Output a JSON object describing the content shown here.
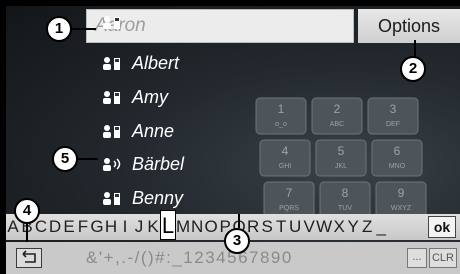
{
  "search": {
    "value": "Aaron"
  },
  "options_label": "Options",
  "contacts": [
    {
      "name": "Albert",
      "icon": "contact-icon"
    },
    {
      "name": "Amy",
      "icon": "contact-icon"
    },
    {
      "name": "Anne",
      "icon": "contact-icon"
    },
    {
      "name": "Bärbel",
      "icon": "voice-tag-contact-icon"
    },
    {
      "name": "Benny",
      "icon": "contact-icon"
    }
  ],
  "letters": [
    "A",
    "B",
    "C",
    "D",
    "E",
    "F",
    "G",
    "H",
    "I",
    "J",
    "K",
    "L",
    "M",
    "N",
    "O",
    "P",
    "Q",
    "R",
    "S",
    "T",
    "U",
    "V",
    "W",
    "X",
    "Y",
    "Z",
    "_"
  ],
  "selected_letter": "L",
  "ok_label": "ok",
  "symbols": "&'+,.-/()#:_1234567890",
  "ellipsis_label": "...",
  "clr_label": "CLR",
  "callouts": [
    "1",
    "2",
    "3",
    "4",
    "5"
  ],
  "keypad_keys": [
    {
      "digit": "1",
      "letters": "o_o"
    },
    {
      "digit": "2",
      "letters": "ABC"
    },
    {
      "digit": "3",
      "letters": "DEF"
    },
    {
      "digit": "4",
      "letters": "GHI"
    },
    {
      "digit": "5",
      "letters": "JKL"
    },
    {
      "digit": "6",
      "letters": "MNO"
    },
    {
      "digit": "7",
      "letters": "PQRS"
    },
    {
      "digit": "8",
      "letters": "TUV"
    },
    {
      "digit": "9",
      "letters": "WXYZ"
    }
  ]
}
